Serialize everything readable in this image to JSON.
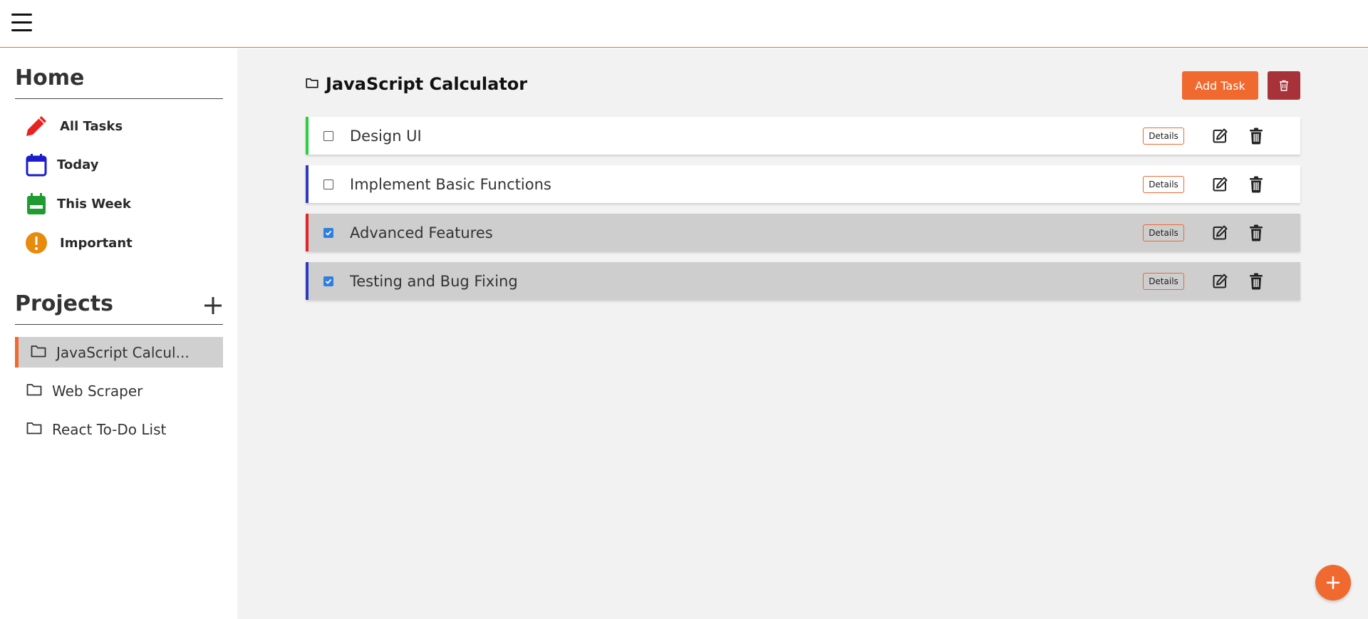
{
  "topbar": {
    "menu_icon": "hamburger-icon"
  },
  "sidebar": {
    "home_title": "Home",
    "nav": [
      {
        "label": "All Tasks",
        "icon": "pencil-icon",
        "color": "#e8231f"
      },
      {
        "label": "Today",
        "icon": "calendar-day-icon",
        "color": "#1c1ccc"
      },
      {
        "label": "This Week",
        "icon": "calendar-week-icon",
        "color": "#1f9c2f"
      },
      {
        "label": "Important",
        "icon": "exclamation-circle-icon",
        "color": "#e88a0c"
      }
    ],
    "projects_title": "Projects",
    "add_project_icon": "plus-icon",
    "projects": [
      {
        "label": "JavaScript Calcul...",
        "icon": "folder-icon",
        "active": true
      },
      {
        "label": "Web Scraper",
        "icon": "folder-icon",
        "active": false
      },
      {
        "label": "React To-Do List",
        "icon": "folder-icon",
        "active": false
      }
    ]
  },
  "main": {
    "project_title": "JavaScript Calculator",
    "project_icon": "folder-icon",
    "add_task_label": "Add Task",
    "delete_project_icon": "trash-icon",
    "tasks": [
      {
        "title": "Design UI",
        "checked": false,
        "priority_color": "#2ecc40"
      },
      {
        "title": "Implement Basic Functions",
        "checked": false,
        "priority_color": "#2f3bbf"
      },
      {
        "title": "Advanced Features",
        "checked": true,
        "priority_color": "#e0262c"
      },
      {
        "title": "Testing and Bug Fixing",
        "checked": true,
        "priority_color": "#2f3bbf"
      }
    ],
    "details_label": "Details",
    "edit_icon": "edit-icon",
    "delete_icon": "trash-icon"
  },
  "fab_icon": "plus-icon",
  "colors": {
    "accent": "#f0692f",
    "danger": "#a8323a",
    "checked": "#2f7fe0"
  }
}
